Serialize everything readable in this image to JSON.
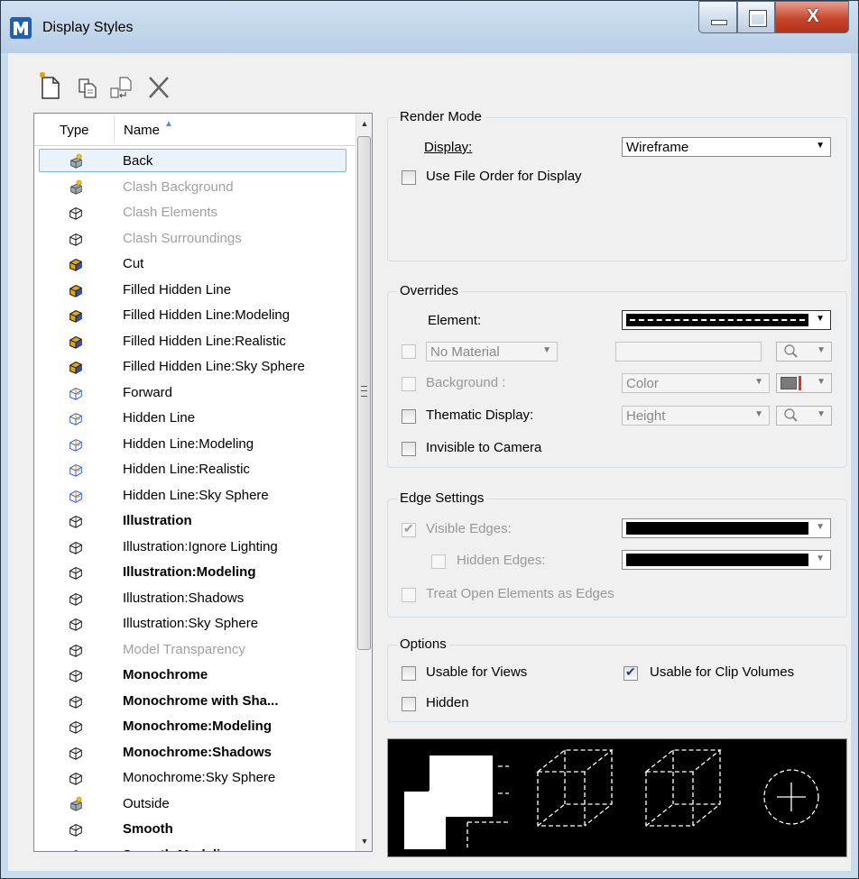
{
  "window": {
    "title": "Display Styles"
  },
  "list": {
    "columns": {
      "type": "Type",
      "name": "Name"
    },
    "rows": [
      {
        "name": "Back",
        "style": "normal",
        "icon": "star-cube-icon",
        "selected": true
      },
      {
        "name": "Clash Background",
        "style": "dim",
        "icon": "star-cube-icon"
      },
      {
        "name": "Clash Elements",
        "style": "dim",
        "icon": "wire-cube-icon"
      },
      {
        "name": "Clash Surroundings",
        "style": "dim",
        "icon": "wire-cube-icon"
      },
      {
        "name": "Cut",
        "style": "normal",
        "icon": "filled-cube-icon"
      },
      {
        "name": "Filled Hidden Line",
        "style": "normal",
        "icon": "filled-cube-icon"
      },
      {
        "name": "Filled Hidden Line:Modeling",
        "style": "normal",
        "icon": "filled-cube-icon"
      },
      {
        "name": "Filled Hidden Line:Realistic",
        "style": "normal",
        "icon": "filled-cube-icon"
      },
      {
        "name": "Filled Hidden Line:Sky Sphere",
        "style": "normal",
        "icon": "filled-cube-icon"
      },
      {
        "name": "Forward",
        "style": "normal",
        "icon": "hidden-cube-icon"
      },
      {
        "name": "Hidden Line",
        "style": "normal",
        "icon": "hidden-cube-icon"
      },
      {
        "name": "Hidden Line:Modeling",
        "style": "normal",
        "icon": "hidden-cube-icon"
      },
      {
        "name": "Hidden Line:Realistic",
        "style": "normal",
        "icon": "hidden-cube-icon"
      },
      {
        "name": "Hidden Line:Sky Sphere",
        "style": "normal",
        "icon": "hidden-cube-icon"
      },
      {
        "name": "Illustration",
        "style": "bold",
        "icon": "wire-cube-icon"
      },
      {
        "name": "Illustration:Ignore Lighting",
        "style": "normal",
        "icon": "wire-cube-icon"
      },
      {
        "name": "Illustration:Modeling",
        "style": "bold",
        "icon": "wire-cube-icon"
      },
      {
        "name": "Illustration:Shadows",
        "style": "normal",
        "icon": "wire-cube-icon"
      },
      {
        "name": "Illustration:Sky Sphere",
        "style": "normal",
        "icon": "wire-cube-icon"
      },
      {
        "name": "Model Transparency",
        "style": "dim",
        "icon": "wire-cube-icon"
      },
      {
        "name": "Monochrome",
        "style": "bold",
        "icon": "wire-cube-icon"
      },
      {
        "name": "Monochrome with Sha...",
        "style": "bold",
        "icon": "wire-cube-icon"
      },
      {
        "name": "Monochrome:Modeling",
        "style": "bold",
        "icon": "wire-cube-icon"
      },
      {
        "name": "Monochrome:Shadows",
        "style": "bold",
        "icon": "wire-cube-icon"
      },
      {
        "name": "Monochrome:Sky Sphere",
        "style": "normal",
        "icon": "wire-cube-icon"
      },
      {
        "name": "Outside",
        "style": "normal",
        "icon": "star-cube-icon"
      },
      {
        "name": "Smooth",
        "style": "bold",
        "icon": "wire-cube-icon"
      },
      {
        "name": "Smooth:Modeling",
        "style": "bold",
        "icon": "wire-cube-icon"
      }
    ]
  },
  "render_mode": {
    "title": "Render Mode",
    "display_label": "Display:",
    "display_value": "Wireframe",
    "use_file_order_label": "Use File Order for Display",
    "use_file_order_checked": false
  },
  "overrides": {
    "title": "Overrides",
    "element_label": "Element:",
    "material_value": "No Material",
    "background_label": "Background :",
    "background_value": "Color",
    "thematic_label": "Thematic Display:",
    "thematic_value": "Height",
    "invisible_label": "Invisible to Camera"
  },
  "edge_settings": {
    "title": "Edge Settings",
    "visible_label": "Visible Edges:",
    "visible_checked": true,
    "hidden_label": "Hidden Edges:",
    "treat_open_label": "Treat Open Elements as Edges"
  },
  "options": {
    "title": "Options",
    "usable_views_label": "Usable for Views",
    "usable_views_checked": false,
    "usable_clip_label": "Usable for Clip Volumes",
    "usable_clip_checked": true,
    "hidden_label": "Hidden",
    "hidden_checked": false
  },
  "colors": {
    "accent": "#7eb4ea",
    "close_button": "#c7452d",
    "titlebar": "#b9cfe6"
  }
}
